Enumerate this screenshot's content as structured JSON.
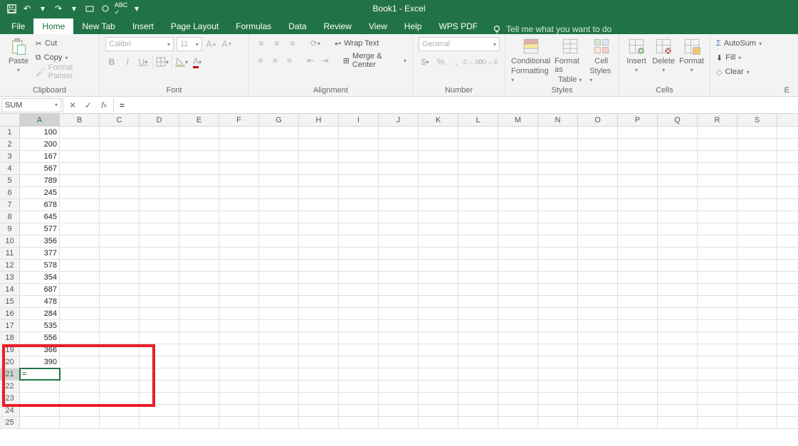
{
  "titlebar": {
    "title": "Book1 - Excel"
  },
  "tabs": {
    "file": "File",
    "items": [
      "Home",
      "New Tab",
      "Insert",
      "Page Layout",
      "Formulas",
      "Data",
      "Review",
      "View",
      "Help",
      "WPS PDF"
    ],
    "active": "Home",
    "tellme": "Tell me what you want to do"
  },
  "ribbon": {
    "clipboard": {
      "label": "Clipboard",
      "paste": "Paste",
      "cut": "Cut",
      "copy": "Copy",
      "formatpainter": "Format Painter"
    },
    "font": {
      "label": "Font",
      "name": "Calibri",
      "size": "11",
      "bold": "B",
      "italic": "I",
      "underline": "U"
    },
    "alignment": {
      "label": "Alignment",
      "wrap": "Wrap Text",
      "merge": "Merge & Center"
    },
    "number": {
      "label": "Number",
      "format": "General"
    },
    "styles": {
      "label": "Styles",
      "cond": "Conditional Formatting",
      "cond1": "Conditional",
      "cond2": "Formatting",
      "table": "Format as Table",
      "table1": "Format as",
      "table2": "Table",
      "cell": "Cell Styles",
      "cell1": "Cell",
      "cell2": "Styles"
    },
    "cells": {
      "label": "Cells",
      "insert": "Insert",
      "delete": "Delete",
      "format": "Format"
    },
    "editing": {
      "label": "E",
      "autosum": "AutoSum",
      "fill": "Fill",
      "clear": "Clear"
    }
  },
  "formula": {
    "namebox": "SUM",
    "input": "="
  },
  "grid": {
    "cols": [
      "A",
      "B",
      "C",
      "D",
      "E",
      "F",
      "G",
      "H",
      "I",
      "J",
      "K",
      "L",
      "M",
      "N",
      "O",
      "P",
      "Q",
      "R",
      "S"
    ],
    "rows": 25,
    "selected_col": "A",
    "selected_row": 21,
    "active_cell_value": "=",
    "data": {
      "1": {
        "A": "100"
      },
      "2": {
        "A": "200"
      },
      "3": {
        "A": "167"
      },
      "4": {
        "A": "567"
      },
      "5": {
        "A": "789"
      },
      "6": {
        "A": "245"
      },
      "7": {
        "A": "678"
      },
      "8": {
        "A": "645"
      },
      "9": {
        "A": "577"
      },
      "10": {
        "A": "356"
      },
      "11": {
        "A": "377"
      },
      "12": {
        "A": "578"
      },
      "13": {
        "A": "354"
      },
      "14": {
        "A": "687"
      },
      "15": {
        "A": "478"
      },
      "16": {
        "A": "284"
      },
      "17": {
        "A": "535"
      },
      "18": {
        "A": "556"
      },
      "19": {
        "A": "366"
      },
      "20": {
        "A": "390"
      }
    }
  }
}
